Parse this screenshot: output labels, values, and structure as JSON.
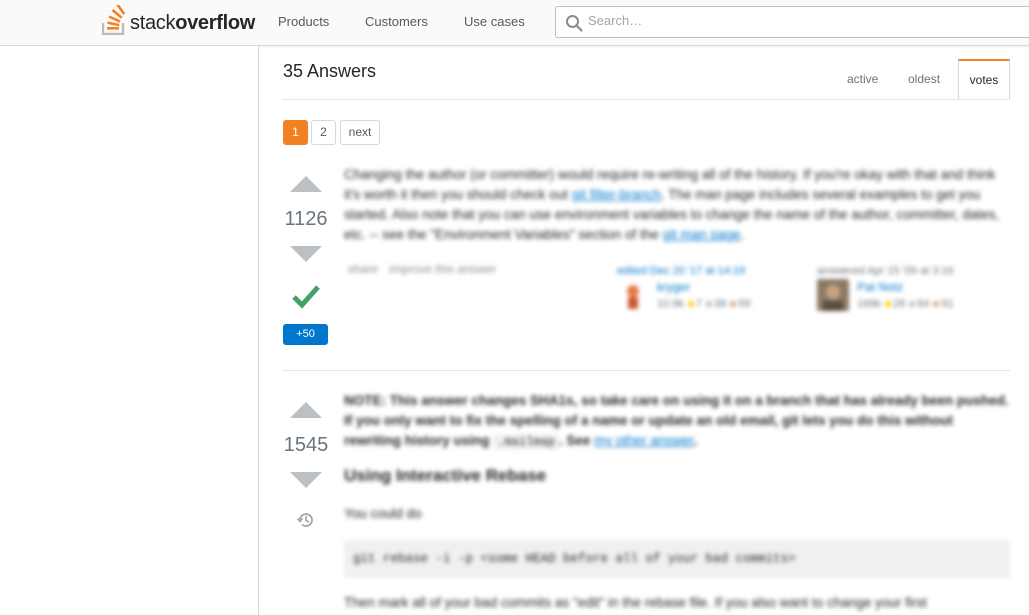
{
  "header": {
    "logo_stack": "stack",
    "logo_overflow": "overflow",
    "nav": [
      "Products",
      "Customers",
      "Use cases"
    ],
    "search_placeholder": "Search…"
  },
  "answers": {
    "title": "35 Answers",
    "tabs": [
      "active",
      "oldest",
      "votes"
    ],
    "active_tab": "votes",
    "pager": [
      "1",
      "2",
      "next"
    ],
    "current_page": "1"
  },
  "answer1": {
    "votes": "1126",
    "accepted": true,
    "bounty": "+50",
    "text_1": "Changing the author (or committer) would require re-writing all of the history. If you're okay with that and think it's worth it then you should check out ",
    "link_1": "git filter-branch",
    "text_2": ". The man page includes several examples to get you started. Also note that you can use environment variables to change the name of the author, committer, dates, etc. -- see the \"Environment Variables\" section of the ",
    "link_2": "git man page",
    "text_3": ".",
    "menu": [
      "share",
      "improve this answer"
    ],
    "edited": {
      "action": "edited Dec 20 '17 at 14:19",
      "user": "kryger",
      "rep": "10.9k",
      "gold": "7",
      "silver": "38",
      "bronze": "59"
    },
    "answered": {
      "action": "answered Apr 15 '09 at 3:16",
      "user": "Pat Notz",
      "rep": "166k",
      "gold": "28",
      "silver": "84",
      "bronze": "91"
    }
  },
  "answer2": {
    "votes": "1545",
    "note_bold": "NOTE: This answer changes SHA1s, so take care on using it on a branch that has already been pushed. If you only want to fix the spelling of a name or update an old email, git lets you do this without rewriting history using ",
    "note_code": ".mailmap",
    "note_bold_2": ". See ",
    "note_link": "my other answer",
    "note_end": ".",
    "heading": "Using Interactive Rebase",
    "you_could_do": "You could do",
    "code": "git rebase -i -p <some HEAD before all of your bad commits>",
    "tail": "Then mark all of your bad commits as \"edit\" in the rebase file. If you also want to change your first"
  },
  "colors": {
    "accent_orange": "#f48024",
    "link_blue": "#0077cc",
    "accepted_green": "#45a163",
    "vote_arrow": "#bbc0c4"
  }
}
